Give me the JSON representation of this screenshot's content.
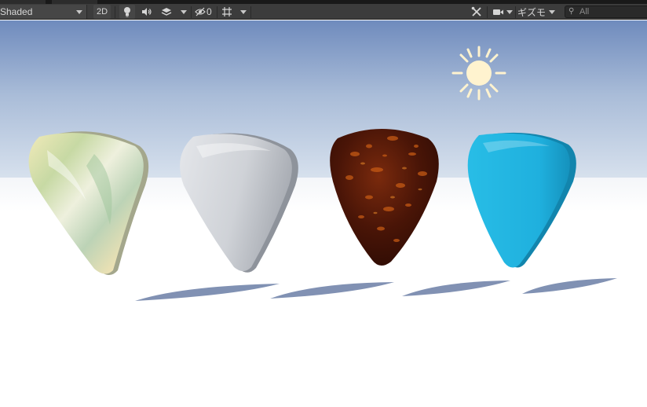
{
  "toolbar": {
    "shading_mode": "Shaded",
    "two_d_label": "2D",
    "hidden_count": "0",
    "gizmos_label": "ギズモ",
    "search_placeholder": "All",
    "icons": {
      "lighting": "lightbulb-icon",
      "audio": "speaker-icon",
      "effects": "layers-icon",
      "visibility": "eye-hidden-icon",
      "grid": "grid-icon",
      "tools": "tools-icon",
      "camera": "camera-icon",
      "search": "search-icon"
    }
  },
  "scene": {
    "objects": [
      {
        "name": "pick-pearl",
        "material": "pearl"
      },
      {
        "name": "pick-white",
        "material": "white"
      },
      {
        "name": "pick-tortoise",
        "material": "tortoise-shell"
      },
      {
        "name": "pick-blue",
        "material": "blue"
      }
    ],
    "colors": {
      "sky_top": "#6f8bbd",
      "sky_horizon": "#dbe4ef",
      "ground": "#ffffff",
      "shadow": "#7688ad",
      "sun": "#fff3cf",
      "blue_pick": "#1fb0de"
    }
  }
}
